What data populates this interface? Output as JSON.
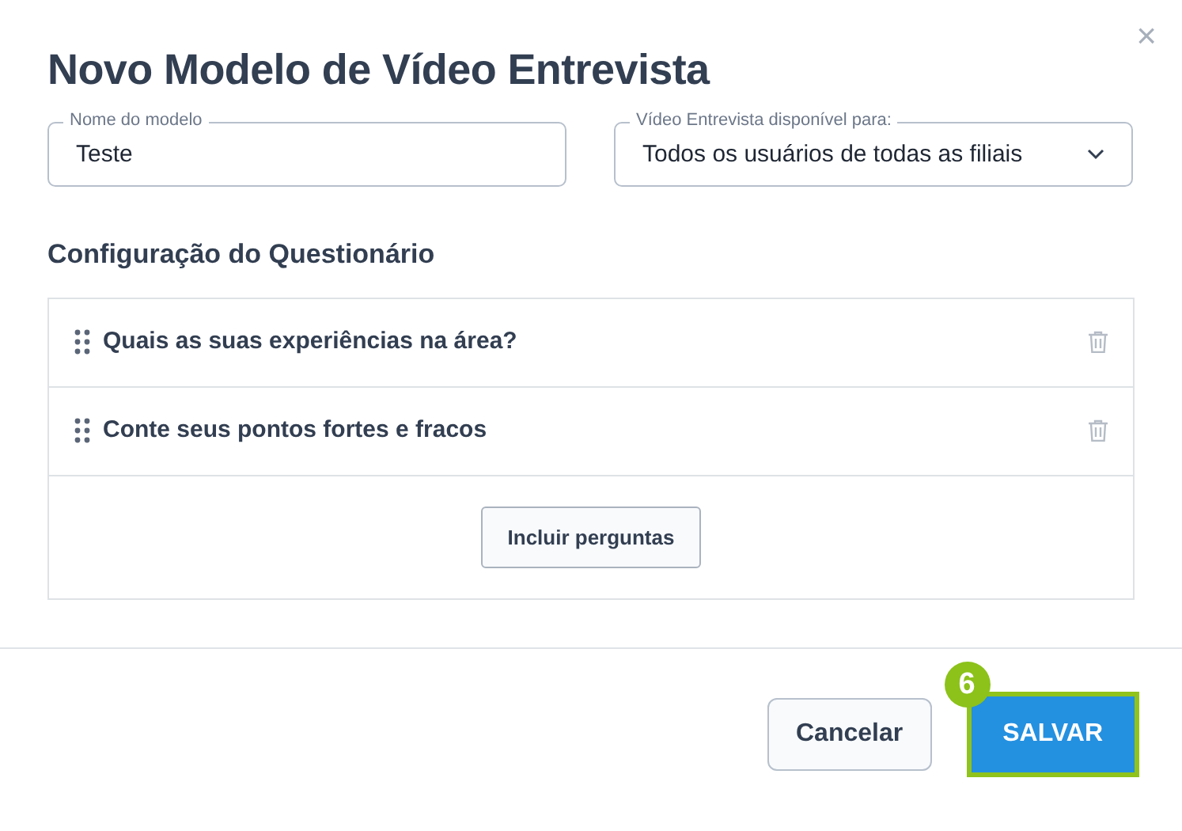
{
  "dialog": {
    "title": "Novo Modelo de Vídeo Entrevista",
    "close": "×"
  },
  "fields": [
    {
      "kind": "text",
      "label": "Nome do modelo",
      "value": "Teste"
    },
    {
      "kind": "select",
      "label": "Vídeo Entrevista disponível para:",
      "value": "Todos os usuários de todas as filiais"
    }
  ],
  "questionnaire": {
    "heading": "Configuração do Questionário",
    "questions": [
      {
        "text": "Quais as suas experiências na área?"
      },
      {
        "text": "Conte seus pontos fortes e fracos"
      }
    ],
    "add_button": "Incluir perguntas"
  },
  "footer": {
    "cancel": "Cancelar",
    "save": "SALVAR",
    "step_badge": "6",
    "save_highlighted": true
  }
}
